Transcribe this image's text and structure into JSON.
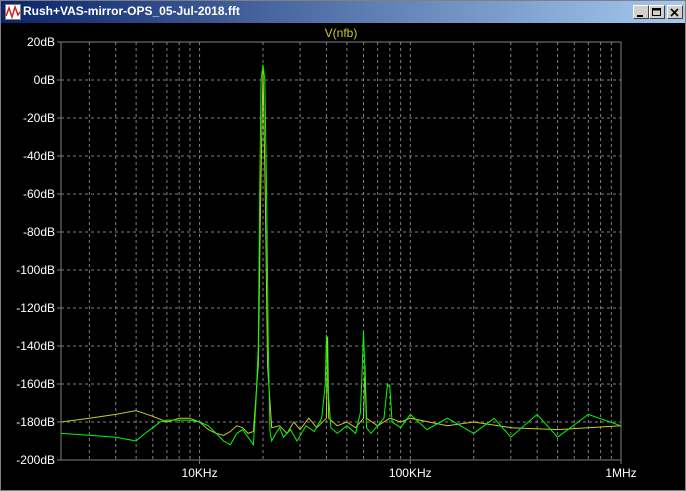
{
  "window": {
    "title": "Rush+VAS-mirror-OPS_05-Jul-2018.fft",
    "controls": [
      "minimize",
      "maximize",
      "close"
    ]
  },
  "colors": {
    "background": "#000000",
    "grid": "#808080",
    "axis_text": "#ffffff",
    "title_text": "#c8c832",
    "series_main": "#00ff00",
    "series_secondary": "#c8c832"
  },
  "chart_data": {
    "type": "line",
    "title": "V(nfb)",
    "xscale": "log",
    "xlim": [
      2200,
      1000000
    ],
    "ylim": [
      -200,
      20
    ],
    "x_ticks": [
      {
        "value": 10000,
        "label": "10KHz"
      },
      {
        "value": 100000,
        "label": "100KHz"
      },
      {
        "value": 1000000,
        "label": "1MHz"
      }
    ],
    "y_ticks": [
      {
        "value": 20,
        "label": "20dB"
      },
      {
        "value": 0,
        "label": "0dB"
      },
      {
        "value": -20,
        "label": "-20dB"
      },
      {
        "value": -40,
        "label": "-40dB"
      },
      {
        "value": -60,
        "label": "-60dB"
      },
      {
        "value": -80,
        "label": "-80dB"
      },
      {
        "value": -100,
        "label": "-100dB"
      },
      {
        "value": -120,
        "label": "-120dB"
      },
      {
        "value": -140,
        "label": "-140dB"
      },
      {
        "value": -160,
        "label": "-160dB"
      },
      {
        "value": -180,
        "label": "-180dB"
      },
      {
        "value": -200,
        "label": "-200dB"
      }
    ],
    "grid": true,
    "series": [
      {
        "color": "#c8c832",
        "x": [
          2200,
          3000,
          4000,
          5000,
          6000,
          7000,
          8000,
          9000,
          10000,
          11000,
          12000,
          13000,
          14000,
          15000,
          16000,
          17000,
          18000,
          19000,
          19500,
          20000,
          20500,
          21000,
          22000,
          24000,
          26000,
          28000,
          30000,
          33000,
          36000,
          40000,
          40500,
          41000,
          45000,
          50000,
          55000,
          60000,
          61000,
          62000,
          70000,
          80000,
          90000,
          100000,
          150000,
          200000,
          300000,
          500000,
          1000000
        ],
        "y": [
          -180,
          -178,
          -176,
          -174,
          -177,
          -180,
          -178,
          -178,
          -180,
          -184,
          -186,
          -187,
          -185,
          -182,
          -183,
          -186,
          -185,
          -150,
          -60,
          5,
          -60,
          -150,
          -183,
          -182,
          -186,
          -180,
          -184,
          -178,
          -183,
          -178,
          -135,
          -178,
          -182,
          -180,
          -183,
          -178,
          -150,
          -178,
          -182,
          -178,
          -180,
          -178,
          -182,
          -180,
          -183,
          -184,
          -182
        ]
      },
      {
        "color": "#00ff00",
        "x": [
          2200,
          3000,
          4000,
          5000,
          5500,
          6000,
          6500,
          7000,
          8000,
          9000,
          10000,
          11000,
          12000,
          13000,
          14000,
          15000,
          16000,
          17000,
          18000,
          18500,
          19000,
          19300,
          19600,
          20000,
          20400,
          20800,
          21200,
          21600,
          22000,
          23000,
          24000,
          25000,
          27000,
          29000,
          32000,
          35000,
          38000,
          39500,
          40000,
          40500,
          42000,
          45000,
          50000,
          55000,
          58000,
          59000,
          60000,
          61000,
          62000,
          65000,
          70000,
          75000,
          78000,
          80000,
          82000,
          90000,
          100000,
          120000,
          150000,
          200000,
          250000,
          300000,
          400000,
          500000,
          700000,
          1000000
        ],
        "y": [
          -186,
          -187,
          -188,
          -190,
          -186,
          -183,
          -180,
          -179,
          -179,
          -179,
          -180,
          -182,
          -186,
          -190,
          -192,
          -186,
          -184,
          -188,
          -192,
          -170,
          -140,
          -60,
          0,
          8,
          0,
          -60,
          -140,
          -185,
          -190,
          -186,
          -183,
          -188,
          -184,
          -190,
          -182,
          -185,
          -178,
          -160,
          -134,
          -160,
          -183,
          -186,
          -182,
          -186,
          -175,
          -155,
          -132,
          -155,
          -183,
          -186,
          -182,
          -178,
          -160,
          -162,
          -180,
          -183,
          -176,
          -184,
          -178,
          -186,
          -178,
          -188,
          -176,
          -188,
          -176,
          -182
        ]
      }
    ]
  }
}
